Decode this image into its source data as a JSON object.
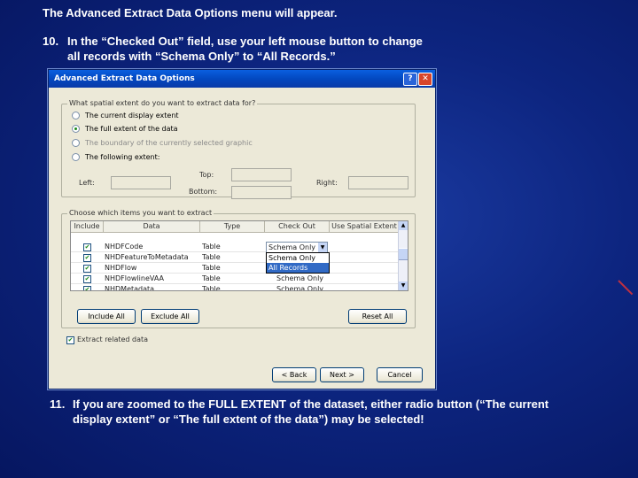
{
  "slide": {
    "line1": "The Advanced Extract Data Options menu will appear.",
    "step10_num": "10.",
    "step10_text": "In the “Checked Out” field, use your left mouse button to change all records with “Schema Only” to “All Records.”",
    "step11_num": "11.",
    "step11_text": "If you are zoomed to the FULL EXTENT of the dataset, either radio button (“The current display extent” or “The full extent of the data”) may be selected!"
  },
  "dialog": {
    "title": "Advanced Extract Data Options",
    "help_glyph": "?",
    "close_glyph": "✕",
    "extent_group_label": "What spatial extent do you want to extract data for?",
    "radios": [
      {
        "label": "The current display extent",
        "selected": false,
        "enabled": true
      },
      {
        "label": "The full extent of the data",
        "selected": true,
        "enabled": true
      },
      {
        "label": "The boundary of the currently selected graphic",
        "selected": false,
        "enabled": false
      },
      {
        "label": "The following extent:",
        "selected": false,
        "enabled": true
      }
    ],
    "extent_fields": {
      "top_label": "Top:",
      "left_label": "Left:",
      "right_label": "Right:",
      "bottom_label": "Bottom:"
    },
    "items_group_label": "Choose which items you want to extract",
    "columns": [
      "Include",
      "Data",
      "Type",
      "Check Out",
      "Use Spatial Extent"
    ],
    "rows": [
      {
        "include": true,
        "data": "NHDFCode",
        "type": "Table",
        "checkout": "Schema Only",
        "spatial": ""
      },
      {
        "include": true,
        "data": "NHDFeatureToMetadata",
        "type": "Table",
        "checkout": "",
        "spatial": ""
      },
      {
        "include": true,
        "data": "NHDFlow",
        "type": "Table",
        "checkout": "",
        "spatial": ""
      },
      {
        "include": true,
        "data": "NHDFlowlineVAA",
        "type": "Table",
        "checkout": "Schema Only",
        "spatial": ""
      },
      {
        "include": true,
        "data": "NHDMetadata",
        "type": "Table",
        "checkout": "Schema Only",
        "spatial": ""
      }
    ],
    "combo_value": "Schema Only",
    "combo_arrow": "▼",
    "dropdown_options": [
      {
        "label": "Schema Only",
        "selected": false
      },
      {
        "label": "All Records",
        "selected": true
      }
    ],
    "scroll_up": "▲",
    "scroll_down": "▼",
    "include_all_label": "Include All",
    "exclude_all_label": "Exclude All",
    "reset_all_label": "Reset All",
    "extract_related_label": "Extract related data",
    "extract_related_checked": true,
    "back_label": "< Back",
    "next_label": "Next >",
    "cancel_label": "Cancel",
    "checkmark": "✔"
  }
}
